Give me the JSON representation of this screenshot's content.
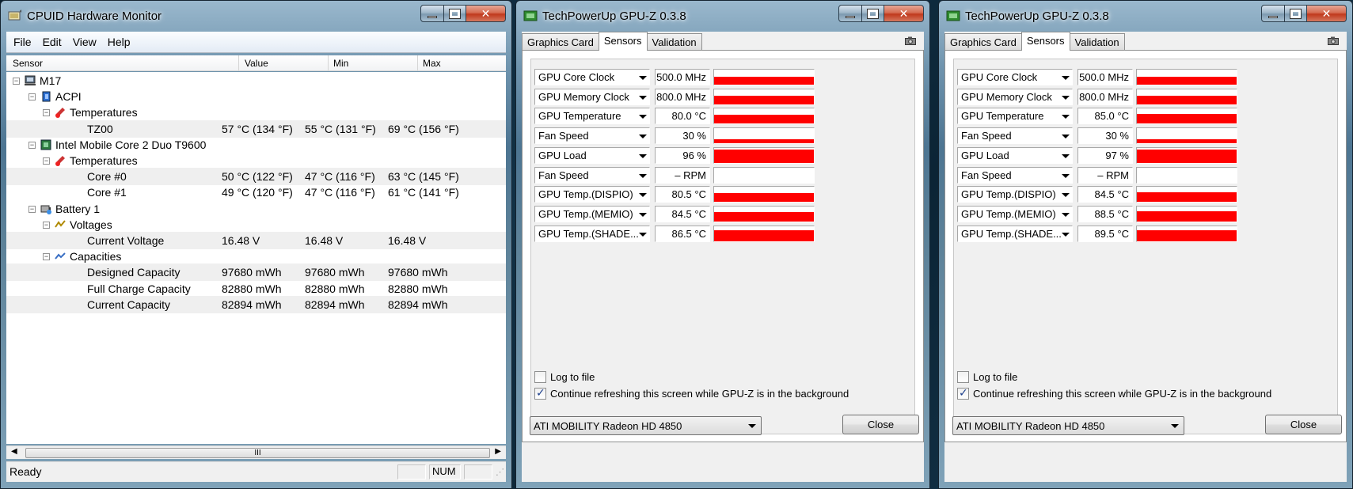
{
  "cpuid": {
    "title": "CPUID Hardware Monitor",
    "menu": [
      "File",
      "Edit",
      "View",
      "Help"
    ],
    "columns": [
      "Sensor",
      "Value",
      "Min",
      "Max"
    ],
    "tree": [
      {
        "label": "M17",
        "value": "",
        "min": "",
        "max": "",
        "level": 0,
        "icon": "computer-icon",
        "expander": "−",
        "shade": false
      },
      {
        "label": "ACPI",
        "value": "",
        "min": "",
        "max": "",
        "level": 1,
        "icon": "chip-icon",
        "expander": "−",
        "shade": false
      },
      {
        "label": "Temperatures",
        "value": "",
        "min": "",
        "max": "",
        "level": 2,
        "icon": "thermometer-icon",
        "expander": "−",
        "shade": false
      },
      {
        "label": "TZ00",
        "value": "57 °C  (134 °F)",
        "min": "55 °C  (131 °F)",
        "max": "69 °C  (156 °F)",
        "level": 3,
        "icon": "",
        "expander": "",
        "shade": true
      },
      {
        "label": "Intel Mobile Core 2 Duo T9600",
        "value": "",
        "min": "",
        "max": "",
        "level": 1,
        "icon": "processor-icon",
        "expander": "−",
        "shade": false
      },
      {
        "label": "Temperatures",
        "value": "",
        "min": "",
        "max": "",
        "level": 2,
        "icon": "thermometer-icon",
        "expander": "−",
        "shade": false
      },
      {
        "label": "Core #0",
        "value": "50 °C  (122 °F)",
        "min": "47 °C  (116 °F)",
        "max": "63 °C  (145 °F)",
        "level": 3,
        "icon": "",
        "expander": "",
        "shade": true
      },
      {
        "label": "Core #1",
        "value": "49 °C  (120 °F)",
        "min": "47 °C  (116 °F)",
        "max": "61 °C  (141 °F)",
        "level": 3,
        "icon": "",
        "expander": "",
        "shade": false
      },
      {
        "label": "Battery 1",
        "value": "",
        "min": "",
        "max": "",
        "level": 1,
        "icon": "battery-icon",
        "expander": "−",
        "shade": false
      },
      {
        "label": "Voltages",
        "value": "",
        "min": "",
        "max": "",
        "level": 2,
        "icon": "voltage-icon",
        "expander": "−",
        "shade": false
      },
      {
        "label": "Current Voltage",
        "value": "16.48 V",
        "min": "16.48 V",
        "max": "16.48 V",
        "level": 3,
        "icon": "",
        "expander": "",
        "shade": true
      },
      {
        "label": "Capacities",
        "value": "",
        "min": "",
        "max": "",
        "level": 2,
        "icon": "capacity-icon",
        "expander": "−",
        "shade": false
      },
      {
        "label": "Designed Capacity",
        "value": "97680 mWh",
        "min": "97680 mWh",
        "max": "97680 mWh",
        "level": 3,
        "icon": "",
        "expander": "",
        "shade": true
      },
      {
        "label": "Full Charge Capacity",
        "value": "82880 mWh",
        "min": "82880 mWh",
        "max": "82880 mWh",
        "level": 3,
        "icon": "",
        "expander": "",
        "shade": false
      },
      {
        "label": "Current Capacity",
        "value": "82894 mWh",
        "min": "82894 mWh",
        "max": "82894 mWh",
        "level": 3,
        "icon": "",
        "expander": "",
        "shade": true
      }
    ],
    "scroll_thumb": "III",
    "status": {
      "text": "Ready",
      "num": "NUM"
    }
  },
  "gpuz": [
    {
      "title": "TechPowerUp GPU-Z 0.3.8",
      "tabs": [
        "Graphics Card",
        "Sensors",
        "Validation"
      ],
      "active_tab": 1,
      "sensors": [
        {
          "name": "GPU Core Clock",
          "value": "500.0 MHz",
          "level": 0.55
        },
        {
          "name": "GPU Memory Clock",
          "value": "800.0 MHz",
          "level": 0.55
        },
        {
          "name": "GPU Temperature",
          "value": "80.0 °C",
          "level": 0.6
        },
        {
          "name": "Fan Speed",
          "value": "30 %",
          "level": 0.25
        },
        {
          "name": "GPU Load",
          "value": "96 %",
          "level": 0.9
        },
        {
          "name": "Fan Speed",
          "value": "– RPM",
          "level": 0
        },
        {
          "name": "GPU Temp.(DISPIO)",
          "value": "80.5 °C",
          "level": 0.6
        },
        {
          "name": "GPU Temp.(MEMIO)",
          "value": "84.5 °C",
          "level": 0.65
        },
        {
          "name": "GPU Temp.(SHADE...",
          "value": "86.5 °C",
          "level": 0.7
        }
      ],
      "log_label": "Log to file",
      "log_checked": false,
      "refresh_label": "Continue refreshing this screen while GPU-Z is in the background",
      "refresh_checked": true,
      "card": "ATI MOBILITY Radeon HD 4850",
      "close_label": "Close"
    },
    {
      "title": "TechPowerUp GPU-Z 0.3.8",
      "tabs": [
        "Graphics Card",
        "Sensors",
        "Validation"
      ],
      "active_tab": 1,
      "sensors": [
        {
          "name": "GPU Core Clock",
          "value": "500.0 MHz",
          "level": 0.55
        },
        {
          "name": "GPU Memory Clock",
          "value": "800.0 MHz",
          "level": 0.55
        },
        {
          "name": "GPU Temperature",
          "value": "85.0 °C",
          "level": 0.65
        },
        {
          "name": "Fan Speed",
          "value": "30 %",
          "level": 0.25
        },
        {
          "name": "GPU Load",
          "value": "97 %",
          "level": 0.9
        },
        {
          "name": "Fan Speed",
          "value": "– RPM",
          "level": 0
        },
        {
          "name": "GPU Temp.(DISPIO)",
          "value": "84.5 °C",
          "level": 0.65
        },
        {
          "name": "GPU Temp.(MEMIO)",
          "value": "88.5 °C",
          "level": 0.7
        },
        {
          "name": "GPU Temp.(SHADE...",
          "value": "89.5 °C",
          "level": 0.72
        }
      ],
      "log_label": "Log to file",
      "log_checked": false,
      "refresh_label": "Continue refreshing this screen while GPU-Z is in the background",
      "refresh_checked": true,
      "card": "ATI MOBILITY Radeon HD 4850",
      "close_label": "Close"
    }
  ],
  "colors": {
    "graph_fill": "#ff0000"
  }
}
